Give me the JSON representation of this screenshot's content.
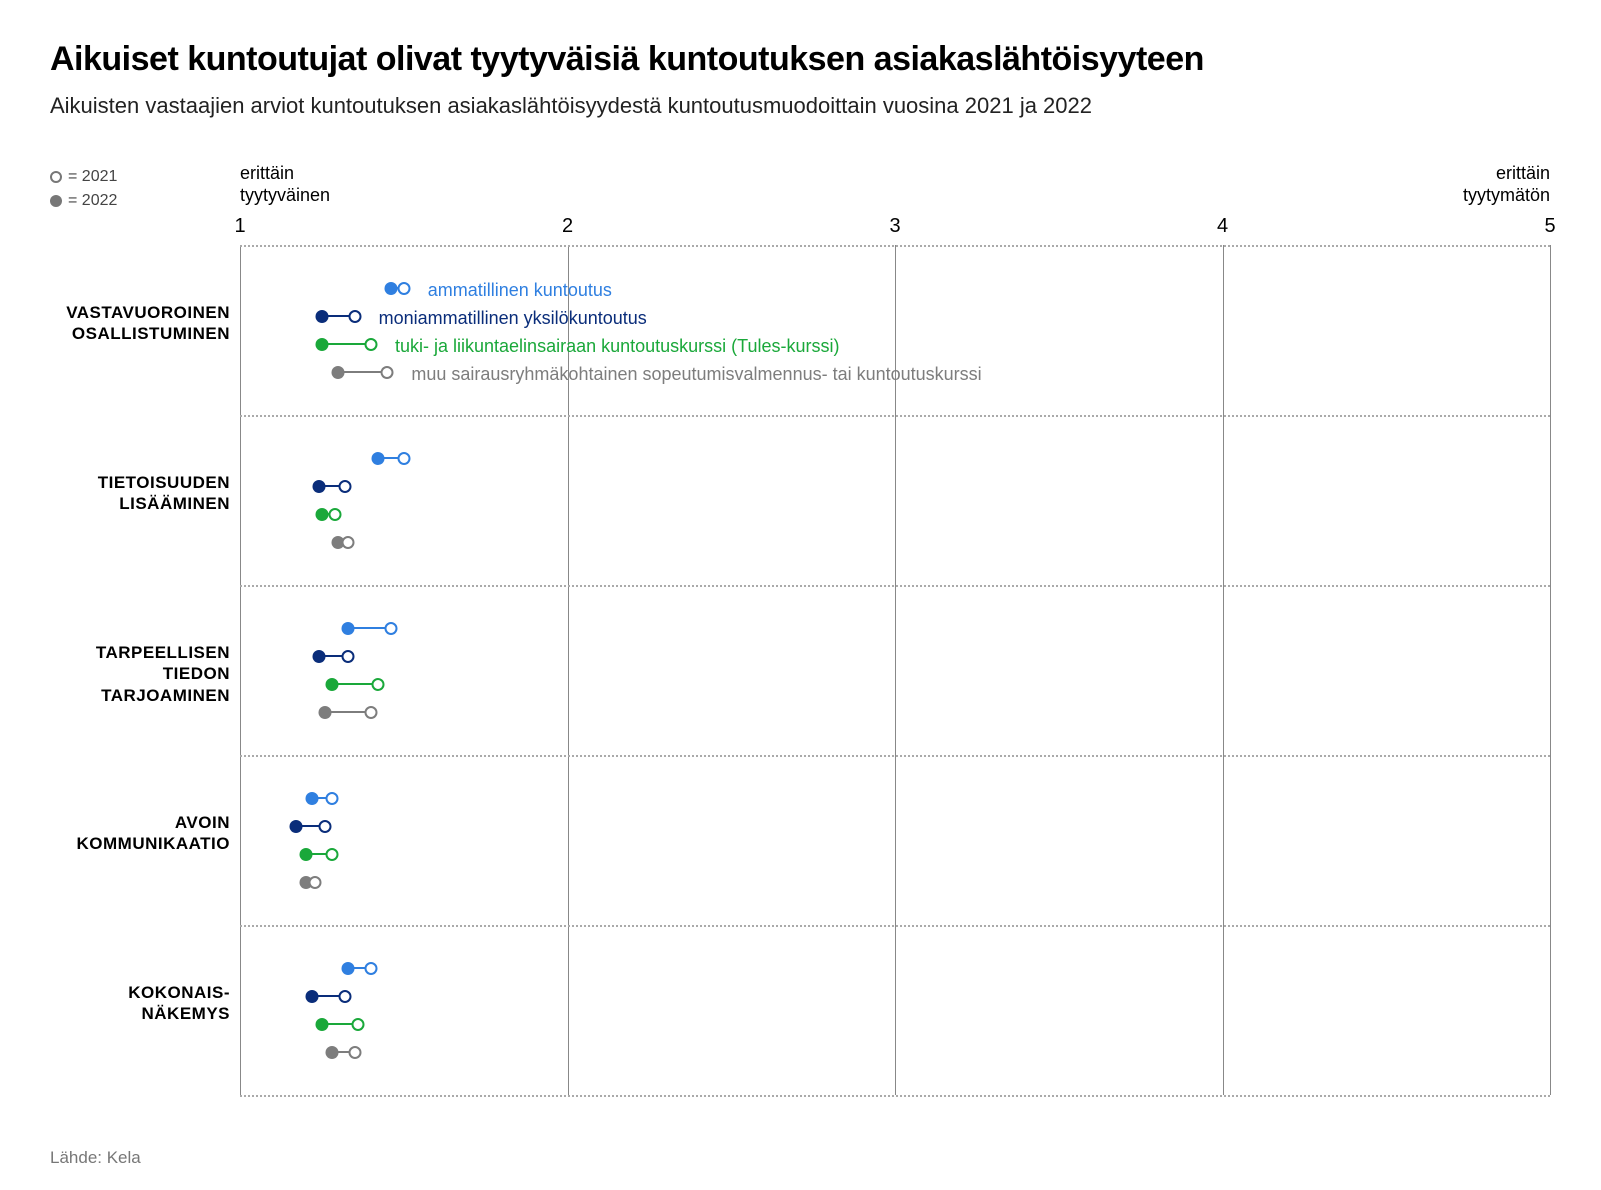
{
  "title": "Aikuiset kuntoutujat olivat tyytyväisiä kuntoutuksen asiakaslähtöisyyteen",
  "subtitle": "Aikuisten vastaajien arviot kuntoutuksen asiakaslähtöisyydestä kuntoutusmuodoittain vuosina 2021 ja 2022",
  "footer": "Lähde: Kela",
  "legend_symbols": {
    "open": "= 2021",
    "closed": "= 2022"
  },
  "axis": {
    "left_label_line1": "erittäin",
    "left_label_line2": "tyytyväinen",
    "right_label_line1": "erittäin",
    "right_label_line2": "tyytymätön",
    "min": 1,
    "max": 5,
    "ticks": [
      "1",
      "2",
      "3",
      "4",
      "5"
    ]
  },
  "series": [
    {
      "key": "ammatillinen",
      "label": "ammatillinen kuntoutus",
      "color": "#2f7fe0"
    },
    {
      "key": "moniammatillinen",
      "label": "moniammatillinen yksilökuntoutus",
      "color": "#0a2d7a"
    },
    {
      "key": "tules",
      "label": "tuki- ja liikuntaelinsairaan kuntoutuskurssi (Tules-kurssi)",
      "color": "#1aa83a"
    },
    {
      "key": "muu",
      "label": "muu sairausryhmäkohtainen sopeutumisvalmennus- tai kuntoutuskurssi",
      "color": "#7d7d7d"
    }
  ],
  "chart_data": {
    "type": "dot",
    "x_range": [
      1,
      5
    ],
    "categories": [
      {
        "key": "vastavuoroinen",
        "label": "VASTAVUOROINEN OSALLISTUMINEN"
      },
      {
        "key": "tietoisuuden",
        "label": "TIETOISUUDEN LISÄÄMINEN"
      },
      {
        "key": "tarpeellisen",
        "label": "TARPEELLISEN TIEDON TARJOAMINEN"
      },
      {
        "key": "avoin",
        "label": "AVOIN KOMMUNIKAATIO"
      },
      {
        "key": "kokonais",
        "label": "KOKONAIS-NÄKEMYS"
      }
    ],
    "data": {
      "vastavuoroinen": {
        "ammatillinen": {
          "y2021": 1.5,
          "y2022": 1.46
        },
        "moniammatillinen": {
          "y2021": 1.35,
          "y2022": 1.25
        },
        "tules": {
          "y2021": 1.4,
          "y2022": 1.25
        },
        "muu": {
          "y2021": 1.45,
          "y2022": 1.3
        }
      },
      "tietoisuuden": {
        "ammatillinen": {
          "y2021": 1.5,
          "y2022": 1.42
        },
        "moniammatillinen": {
          "y2021": 1.32,
          "y2022": 1.24
        },
        "tules": {
          "y2021": 1.29,
          "y2022": 1.25
        },
        "muu": {
          "y2021": 1.33,
          "y2022": 1.3
        }
      },
      "tarpeellisen": {
        "ammatillinen": {
          "y2021": 1.46,
          "y2022": 1.33
        },
        "moniammatillinen": {
          "y2021": 1.33,
          "y2022": 1.24
        },
        "tules": {
          "y2021": 1.42,
          "y2022": 1.28
        },
        "muu": {
          "y2021": 1.4,
          "y2022": 1.26
        }
      },
      "avoin": {
        "ammatillinen": {
          "y2021": 1.28,
          "y2022": 1.22
        },
        "moniammatillinen": {
          "y2021": 1.26,
          "y2022": 1.17
        },
        "tules": {
          "y2021": 1.28,
          "y2022": 1.2
        },
        "muu": {
          "y2021": 1.23,
          "y2022": 1.2
        }
      },
      "kokonais": {
        "ammatillinen": {
          "y2021": 1.4,
          "y2022": 1.33
        },
        "moniammatillinen": {
          "y2021": 1.32,
          "y2022": 1.22
        },
        "tules": {
          "y2021": 1.36,
          "y2022": 1.25
        },
        "muu": {
          "y2021": 1.35,
          "y2022": 1.28
        }
      }
    }
  }
}
